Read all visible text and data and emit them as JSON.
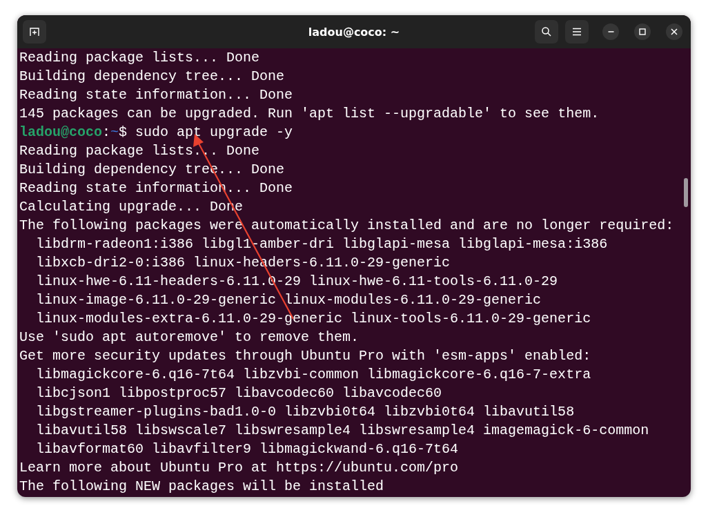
{
  "window": {
    "title": "ladou@coco: ~"
  },
  "terminal": {
    "lines": [
      {
        "kind": "output",
        "text": "Reading package lists... Done"
      },
      {
        "kind": "output",
        "text": "Building dependency tree... Done"
      },
      {
        "kind": "output",
        "text": "Reading state information... Done"
      },
      {
        "kind": "output",
        "text": "145 packages can be upgraded. Run 'apt list --upgradable' to see them."
      },
      {
        "kind": "prompt",
        "user_host": "ladou@coco",
        "separator": ":",
        "path": "~",
        "command": "$ sudo apt upgrade -y"
      },
      {
        "kind": "output",
        "text": "Reading package lists... Done"
      },
      {
        "kind": "output",
        "text": "Building dependency tree... Done"
      },
      {
        "kind": "output",
        "text": "Reading state information... Done"
      },
      {
        "kind": "output",
        "text": "Calculating upgrade... Done"
      },
      {
        "kind": "output",
        "text": "The following packages were automatically installed and are no longer required:"
      },
      {
        "kind": "indented",
        "text": "libdrm-radeon1:i386 libgl1-amber-dri libglapi-mesa libglapi-mesa:i386"
      },
      {
        "kind": "indented",
        "text": "libxcb-dri2-0:i386 linux-headers-6.11.0-29-generic"
      },
      {
        "kind": "indented",
        "text": "linux-hwe-6.11-headers-6.11.0-29 linux-hwe-6.11-tools-6.11.0-29"
      },
      {
        "kind": "indented",
        "text": "linux-image-6.11.0-29-generic linux-modules-6.11.0-29-generic"
      },
      {
        "kind": "indented",
        "text": "linux-modules-extra-6.11.0-29-generic linux-tools-6.11.0-29-generic"
      },
      {
        "kind": "output",
        "text": "Use 'sudo apt autoremove' to remove them."
      },
      {
        "kind": "output",
        "text": "Get more security updates through Ubuntu Pro with 'esm-apps' enabled:"
      },
      {
        "kind": "indented",
        "text": "libmagickcore-6.q16-7t64 libzvbi-common libmagickcore-6.q16-7-extra"
      },
      {
        "kind": "indented",
        "text": "libcjson1 libpostproc57 libavcodec60 libavcodec60"
      },
      {
        "kind": "indented",
        "text": "libgstreamer-plugins-bad1.0-0 libzvbi0t64 libzvbi0t64 libavutil58"
      },
      {
        "kind": "indented",
        "text": "libavutil58 libswscale7 libswresample4 libswresample4 imagemagick-6-common"
      },
      {
        "kind": "indented",
        "text": "libavformat60 libavfilter9 libmagickwand-6.q16-7t64"
      },
      {
        "kind": "output",
        "text": "Learn more about Ubuntu Pro at https://ubuntu.com/pro"
      },
      {
        "kind": "output",
        "text": "The following NEW packages will be installed"
      }
    ]
  }
}
